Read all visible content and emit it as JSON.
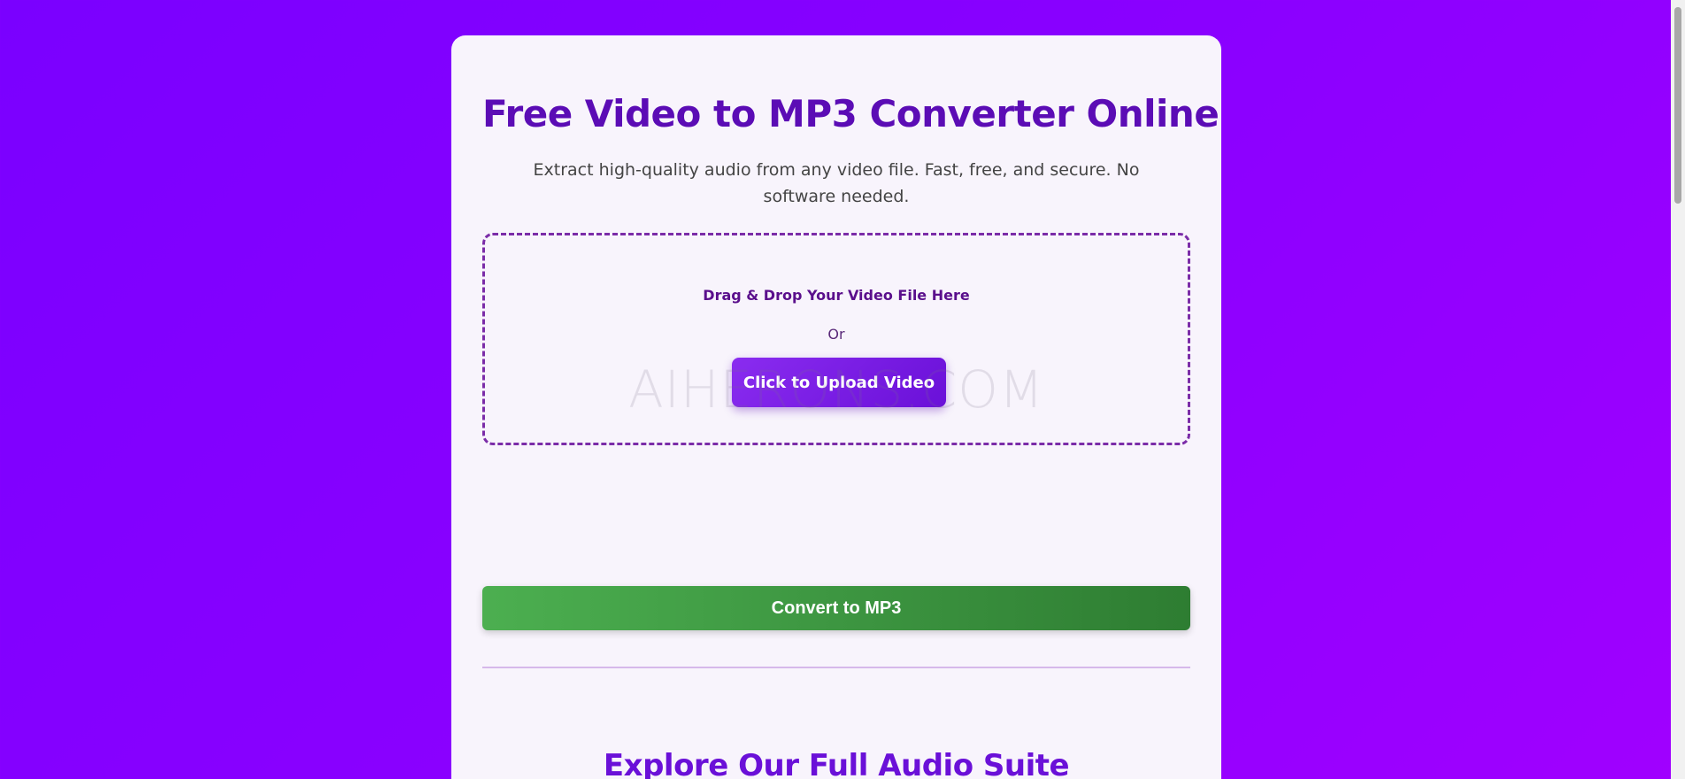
{
  "header": {
    "title": "Free Video to MP3 Converter Online",
    "subtitle": "Extract high-quality audio from any video file. Fast, free, and secure. No software needed."
  },
  "dropzone": {
    "title": "Drag & Drop Your Video File Here",
    "or_text": "Or",
    "upload_label": "Click to Upload Video",
    "watermark": "AIHERONS.COM"
  },
  "actions": {
    "convert_label": "Convert to MP3"
  },
  "suite": {
    "title": "Explore Our Full Audio Suite"
  },
  "colors": {
    "background": "#8a00ff",
    "title": "#5b0cb5",
    "upload_button": "#7a1fe6",
    "convert_button": "#43a047",
    "dropzone_border": "#7b2ca8"
  }
}
